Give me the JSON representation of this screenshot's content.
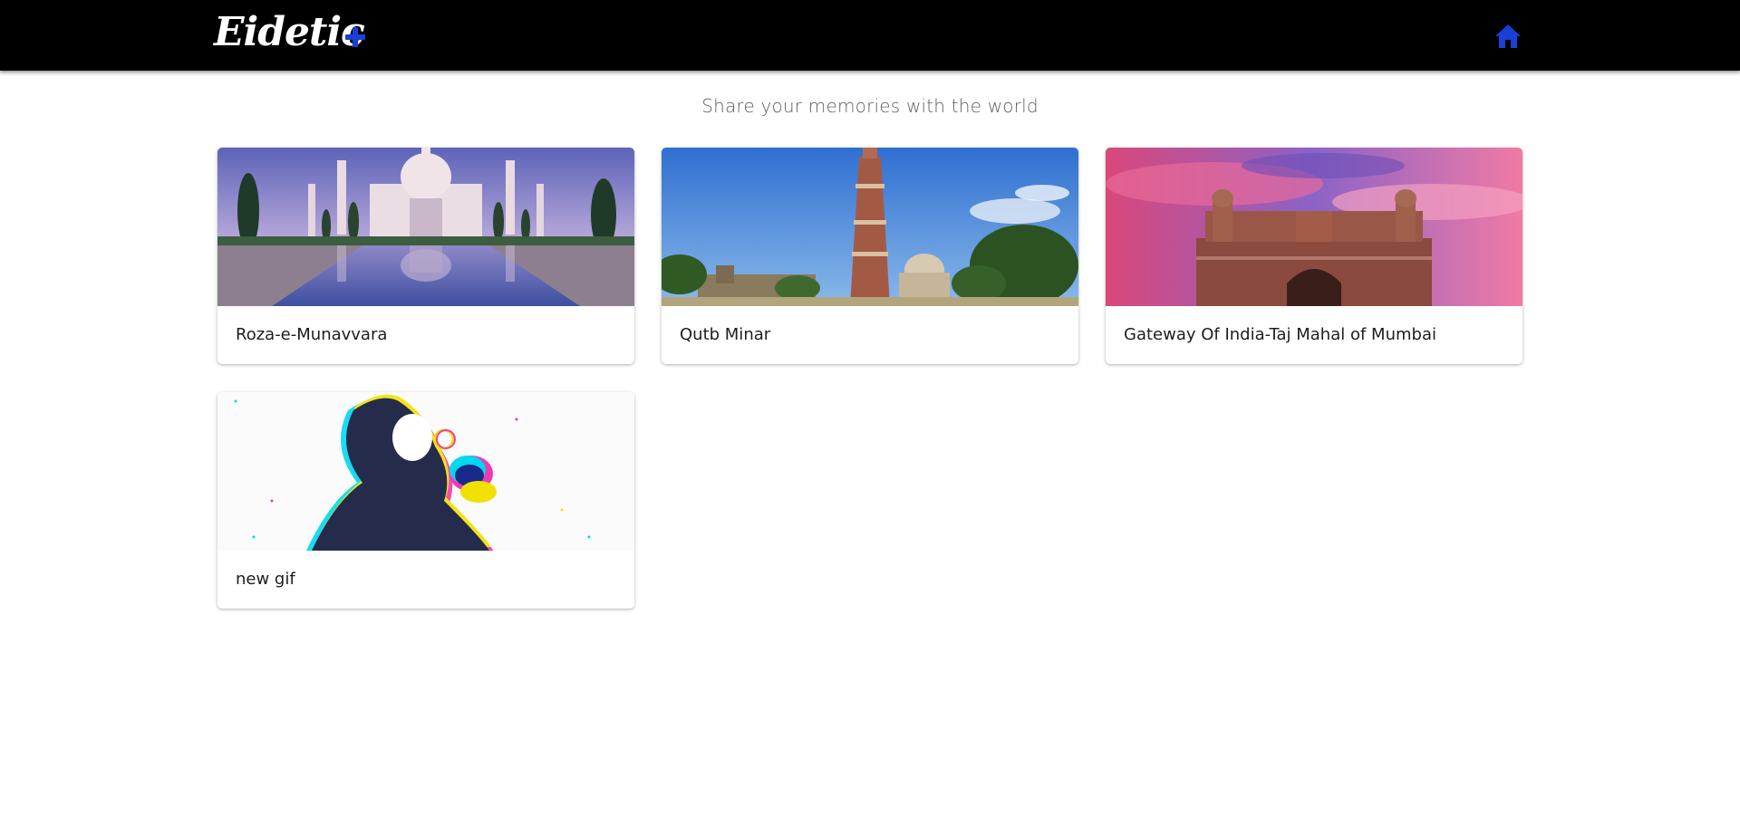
{
  "app": {
    "brand": "Eidetic",
    "accent_color": "#1a3fd6",
    "icons": {
      "add": "plus-icon",
      "home": "home-icon"
    }
  },
  "page": {
    "tagline": "Share your memories with the world"
  },
  "memories": [
    {
      "title": "Roza-e-Munavvara",
      "image": "taj-mahal-photo"
    },
    {
      "title": "Qutb Minar",
      "image": "qutb-minar-photo"
    },
    {
      "title": "Gateway Of India-Taj Mahal of Mumbai",
      "image": "gateway-of-india-photo"
    },
    {
      "title": "new gif",
      "image": "cartoon-gif"
    }
  ]
}
